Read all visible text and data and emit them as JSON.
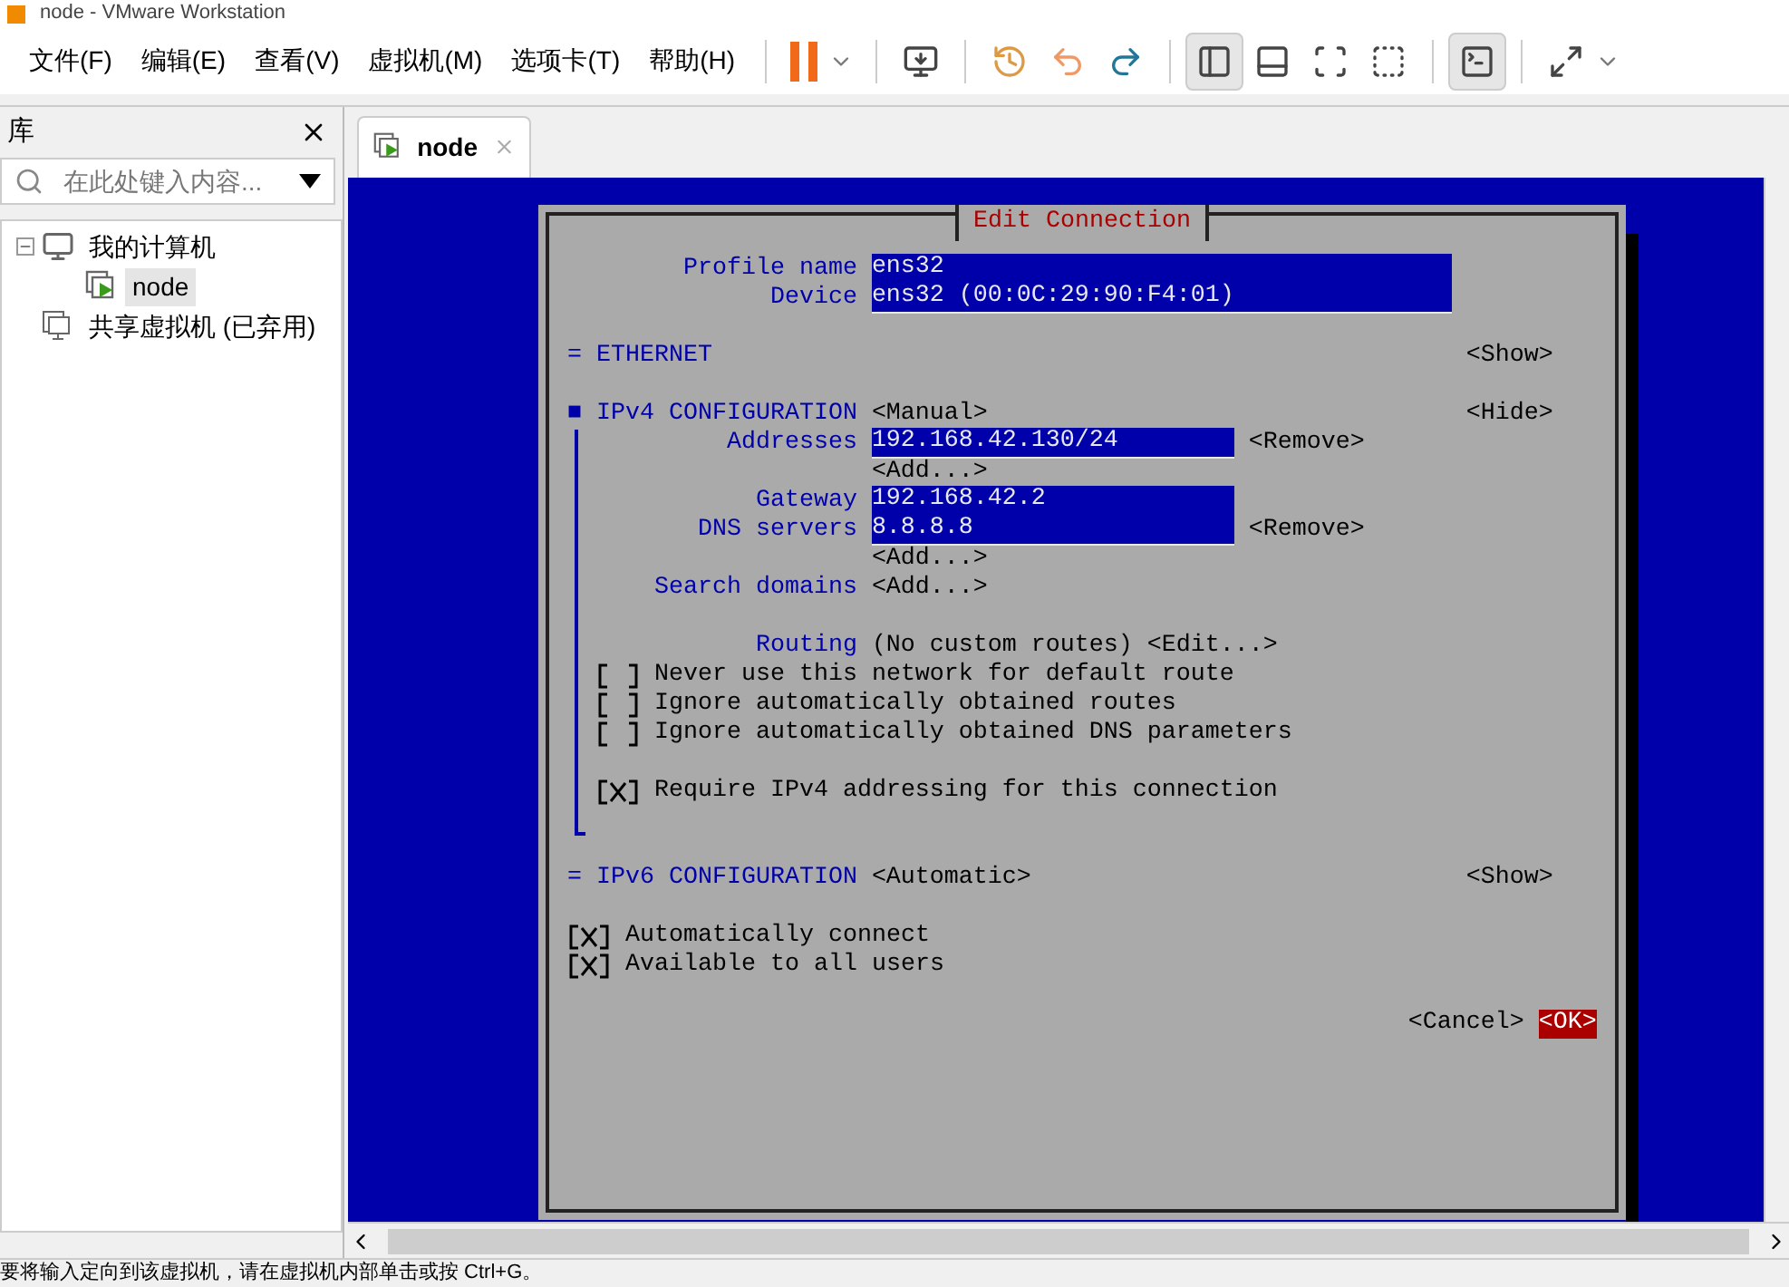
{
  "window": {
    "title": "node - VMware Workstation"
  },
  "menu": [
    "文件(F)",
    "编辑(E)",
    "查看(V)",
    "虚拟机(M)",
    "选项卡(T)",
    "帮助(H)"
  ],
  "library": {
    "title": "库",
    "search": {
      "placeholder": "在此处键入内容..."
    },
    "tree": [
      {
        "label": "我的计算机",
        "kind": "computer",
        "expanded": true,
        "selected": false,
        "children": [
          {
            "label": "node",
            "kind": "vm",
            "selected": true
          }
        ]
      },
      {
        "label": "共享虚拟机 (已弃用)",
        "kind": "shared",
        "selected": false
      }
    ]
  },
  "tabs": [
    {
      "label": "node",
      "selected": true
    }
  ],
  "terminal": {
    "title": "Edit Connection",
    "profile": {
      "label": "Profile name",
      "value": "ens32"
    },
    "device": {
      "label": "Device",
      "value": "ens32 (00:0C:29:90:F4:01)"
    },
    "ethernet": {
      "marker": "=",
      "label": "ETHERNET",
      "toggle": "<Show>"
    },
    "ipv4": {
      "marker": "■",
      "label": "IPv4 CONFIGURATION",
      "mode": "<Manual>",
      "toggle": "<Hide>",
      "expanded": true,
      "addresses": {
        "label": "Addresses",
        "values": [
          "192.168.42.130/24"
        ],
        "remove": "<Remove>",
        "add": "<Add...>"
      },
      "gateway": {
        "label": "Gateway",
        "value": "192.168.42.2"
      },
      "dns": {
        "label": "DNS servers",
        "values": [
          "8.8.8.8"
        ],
        "remove": "<Remove>",
        "add": "<Add...>"
      },
      "search_domains": {
        "label": "Search domains",
        "add": "<Add...>"
      },
      "routing": {
        "label": "Routing",
        "value": "(No custom routes)",
        "edit": "<Edit...>"
      },
      "options": [
        {
          "label": "Never use this network for default route",
          "checked": false
        },
        {
          "label": "Ignore automatically obtained routes",
          "checked": false
        },
        {
          "label": "Ignore automatically obtained DNS parameters",
          "checked": false
        }
      ],
      "require": {
        "label": "Require IPv4 addressing for this connection",
        "checked": true
      }
    },
    "ipv6": {
      "marker": "=",
      "label": "IPv6 CONFIGURATION",
      "mode": "<Automatic>",
      "toggle": "<Show>"
    },
    "options": [
      {
        "label": "Automatically connect",
        "checked": true
      },
      {
        "label": "Available to all users",
        "checked": true
      }
    ],
    "buttons": [
      {
        "label": "<Cancel>",
        "selected": false
      },
      {
        "label": "<OK>",
        "selected": true
      }
    ]
  },
  "status_bar": {
    "text": "要将输入定向到该虚拟机，请在虚拟机内部单击或按 Ctrl+G。"
  }
}
